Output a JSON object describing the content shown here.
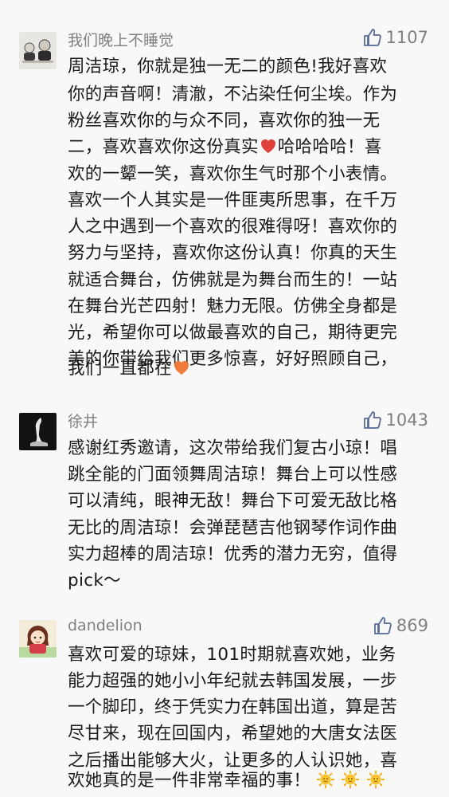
{
  "comments": [
    {
      "user": "我们晚上不睡觉",
      "likes": "1107",
      "avatar_icon": "figurines-avatar-icon",
      "lines": [
        "周洁琼，你就是独一无二的颜色!我好喜欢",
        "你的声音啊！清澈，不沾染任何尘埃。作为",
        "粉丝喜欢你的与众不同，喜欢你的独一无",
        "二，喜欢喜欢你这份真实",
        "哈哈哈哈！喜",
        "欢的一颦一笑，喜欢你生气时那个小表情。",
        "喜欢一个人其实是一件匪夷所思事，在千万",
        "人之中遇到一个喜欢的很难得呀！喜欢你的",
        "努力与坚持，喜欢你这份认真！你真的天生",
        "就适合舞台，仿佛就是为舞台而生的！一站",
        "在舞台光芒四射！魅力无限。仿佛全身都是",
        "光，希望你可以做最喜欢的自己，期待更完",
        "美的你带给我们更多惊喜，好好照顾自己，",
        "我们一直都在"
      ]
    },
    {
      "user": "徐井",
      "likes": "1043",
      "avatar_icon": "dancer-silhouette-avatar-icon",
      "lines": [
        "感谢红秀邀请，这次带给我们复古小琼！唱",
        "跳全能的门面领舞周洁琼！舞台上可以性感",
        "可以清纯，眼神无敌！舞台下可爱无敌比格",
        "无比的周洁琼！会弹琵琶吉他钢琴作词作曲",
        "实力超棒的周洁琼！优秀的潜力无穷，值得",
        "pick～"
      ]
    },
    {
      "user": "dandelion",
      "likes": "869",
      "avatar_icon": "cartoon-girl-avatar-icon",
      "lines": [
        "喜欢可爱的琼妹，101时期就喜欢她，业务",
        "能力超强的她小小年纪就去韩国发展，一步",
        "一个脚印，终于凭实力在韩国出道，算是苦",
        "尽甘来，现在回国内，希望她的大唐女法医",
        "之后播出能够大火，让更多的人认识她，喜",
        "欢她真的是一件非常幸福的事！"
      ]
    }
  ],
  "colors": {
    "background": "#f8f8f8",
    "username": "#7f7f7f",
    "like_icon": "#576b95",
    "heart_red": "#e0403a",
    "heart_orange": "#f07a3a",
    "sun": "#f2b21c"
  }
}
